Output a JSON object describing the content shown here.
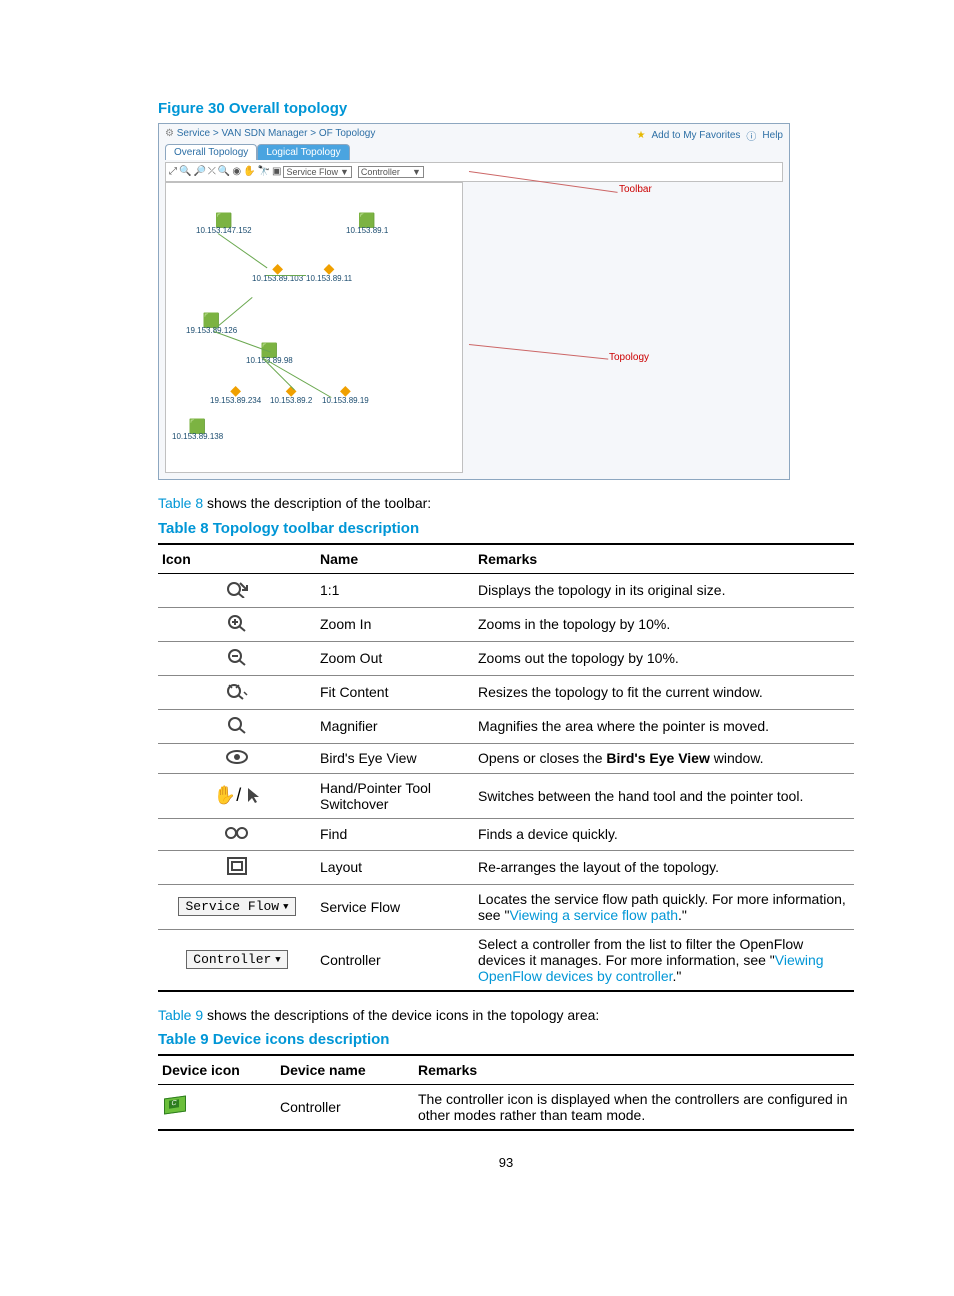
{
  "figure_title": "Figure 30 Overall topology",
  "breadcrumb": "Service  >  VAN SDN Manager  >  OF Topology",
  "fav": "Add to My Favorites",
  "help": "Help",
  "tabs": [
    "Overall Topology",
    "Logical Topology"
  ],
  "toolbar_drop1": "Service Flow",
  "toolbar_drop2": "Controller",
  "label_toolbar": "Toolbar",
  "label_topology": "Topology",
  "nodes": {
    "a": "10.153.147.152",
    "b": "10.153.89.1",
    "c": "10.153.89.103",
    "d": "10.153.89.11",
    "e": "19.153.89.126",
    "f": "10.153.89.98",
    "g": "19.153.89.234",
    "h": "10.153.89.2",
    "i": "10.153.89.19",
    "j": "10.153.89.138"
  },
  "para1_pre": "Table 8",
  "para1_post": " shows the description of the toolbar:",
  "table8_title": "Table 8 Topology toolbar description",
  "t8h": [
    "Icon",
    "Name",
    "Remarks"
  ],
  "t8": [
    {
      "icon": "one",
      "name": "1:1",
      "rem": "Displays the topology in its original size."
    },
    {
      "icon": "zin",
      "name": "Zoom In",
      "rem": "Zooms in the topology by 10%."
    },
    {
      "icon": "zout",
      "name": "Zoom Out",
      "rem": "Zooms out the topology by 10%."
    },
    {
      "icon": "fit",
      "name": "Fit Content",
      "rem": "Resizes the topology to fit the current window."
    },
    {
      "icon": "mag",
      "name": "Magnifier",
      "rem": "Magnifies the area where the pointer is moved."
    },
    {
      "icon": "eye",
      "name": "Bird's Eye View",
      "rem": "Opens or closes the Bird's Eye View window.",
      "bold": "Bird's Eye View"
    },
    {
      "icon": "hand",
      "name": "Hand/Pointer Tool Switchover",
      "rem": "Switches between the hand tool and the pointer tool."
    },
    {
      "icon": "find",
      "name": "Find",
      "rem": "Finds a device quickly."
    },
    {
      "icon": "lay",
      "name": "Layout",
      "rem": "Re-arranges the layout of the topology."
    },
    {
      "icon": "sf",
      "drop": "Service Flow",
      "name": "Service Flow",
      "pre": "Locates the service flow path quickly. For more information, see \"",
      "link": "Viewing a service flow path",
      "post": ".\""
    },
    {
      "icon": "ctl",
      "drop": "Controller",
      "name": "Controller",
      "pre": "Select a controller from the list to filter the OpenFlow devices it manages. For more information, see \"",
      "link": "Viewing OpenFlow devices by controller",
      "post": ".\""
    }
  ],
  "para2_pre": "Table 9",
  "para2_post": " shows the descriptions of the device icons in the topology area:",
  "table9_title": "Table 9 Device icons description",
  "t9h": [
    "Device icon",
    "Device name",
    "Remarks"
  ],
  "t9": {
    "name": "Controller",
    "rem": "The controller icon is displayed when the controllers are configured in other modes rather than team mode."
  },
  "page_number": "93"
}
